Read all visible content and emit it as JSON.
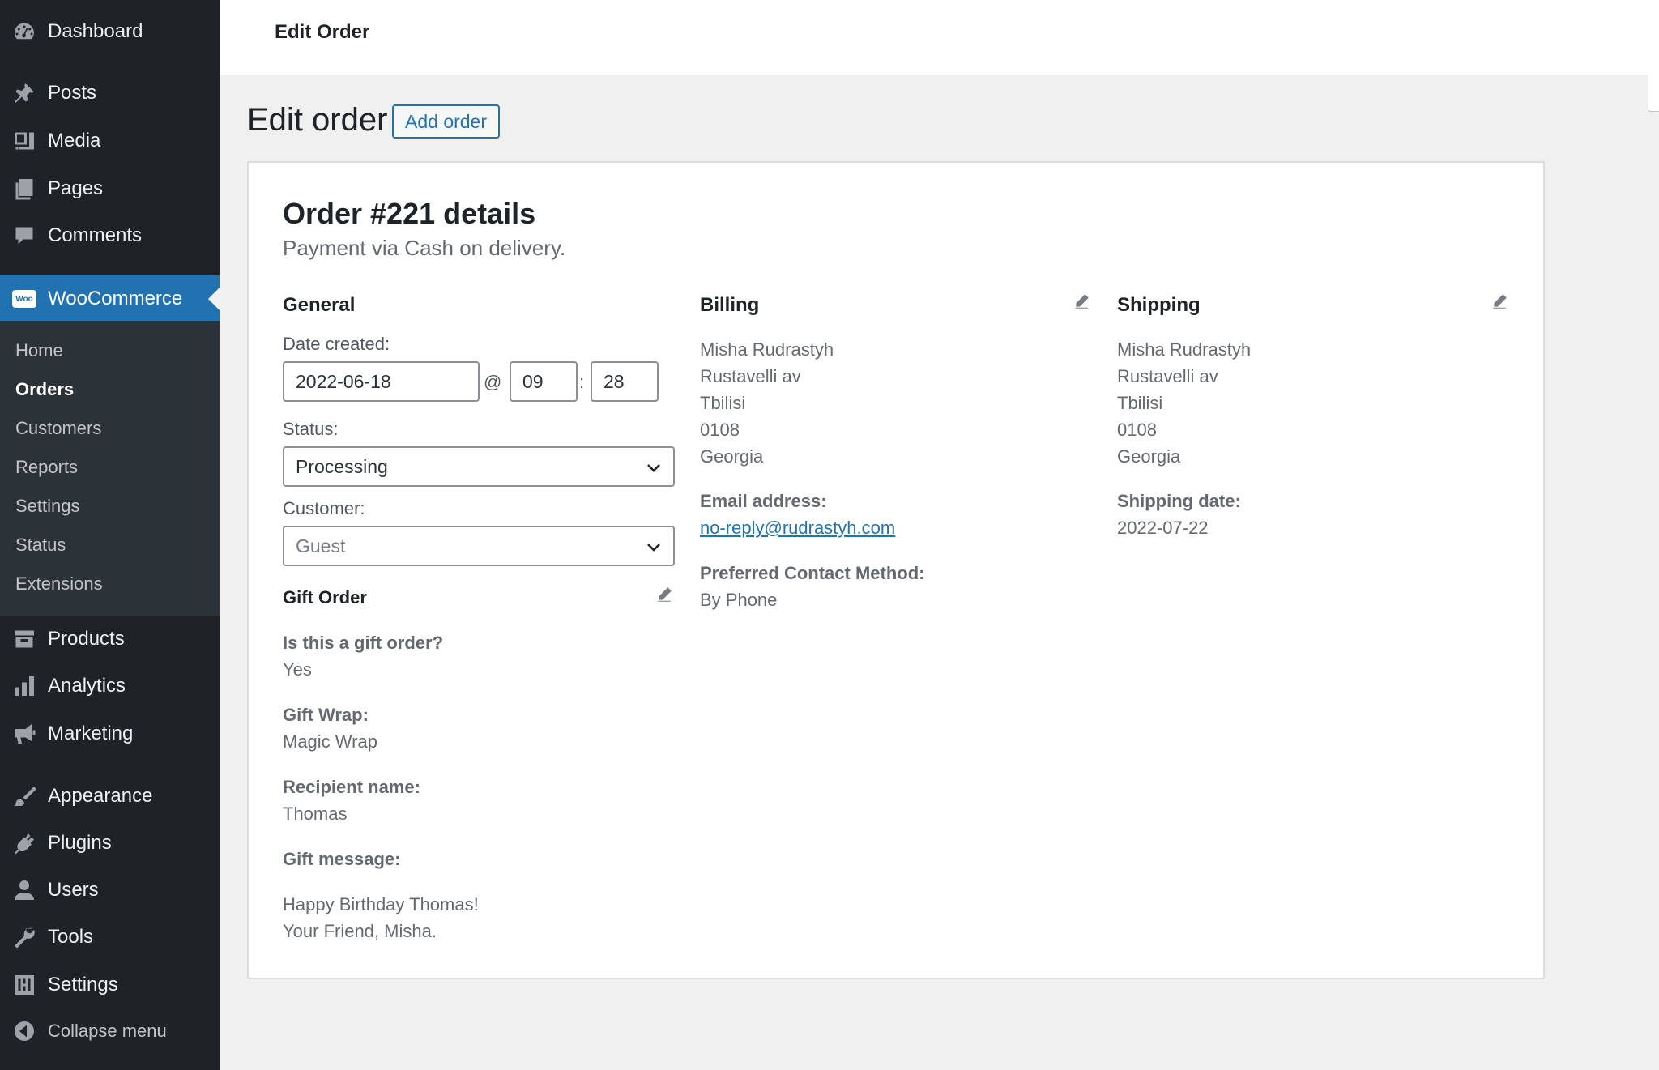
{
  "sidebar": {
    "items": [
      {
        "id": "dashboard",
        "label": "Dashboard",
        "icon": "dashboard-icon"
      },
      {
        "id": "posts",
        "label": "Posts",
        "icon": "pin-icon"
      },
      {
        "id": "media",
        "label": "Media",
        "icon": "media-icon"
      },
      {
        "id": "pages",
        "label": "Pages",
        "icon": "pages-icon"
      },
      {
        "id": "comments",
        "label": "Comments",
        "icon": "comment-icon"
      },
      {
        "id": "woocommerce",
        "label": "WooCommerce",
        "icon": "woocommerce-icon"
      },
      {
        "id": "products",
        "label": "Products",
        "icon": "archive-icon"
      },
      {
        "id": "analytics",
        "label": "Analytics",
        "icon": "bar-chart-icon"
      },
      {
        "id": "marketing",
        "label": "Marketing",
        "icon": "megaphone-icon"
      },
      {
        "id": "appearance",
        "label": "Appearance",
        "icon": "brush-icon"
      },
      {
        "id": "plugins",
        "label": "Plugins",
        "icon": "plug-icon"
      },
      {
        "id": "users",
        "label": "Users",
        "icon": "user-icon"
      },
      {
        "id": "tools",
        "label": "Tools",
        "icon": "wrench-icon"
      },
      {
        "id": "settings",
        "label": "Settings",
        "icon": "sliders-icon"
      },
      {
        "id": "collapse",
        "label": "Collapse menu",
        "icon": "collapse-icon"
      }
    ],
    "submenu": [
      "Home",
      "Orders",
      "Customers",
      "Reports",
      "Settings",
      "Status",
      "Extensions"
    ],
    "woo_logo_text": "Woo"
  },
  "header": {
    "title": "Edit Order"
  },
  "page": {
    "title": "Edit order",
    "add_button": "Add order"
  },
  "order": {
    "heading": "Order #221 details",
    "payment": "Payment via Cash on delivery."
  },
  "general": {
    "heading": "General",
    "date_label": "Date created:",
    "date": "2022-06-18",
    "at": "@",
    "hour": "09",
    "colon": ":",
    "minute": "28",
    "status_label": "Status:",
    "status": "Processing",
    "customer_label": "Customer:",
    "customer": "Guest"
  },
  "gift": {
    "heading": "Gift Order",
    "q_label": "Is this a gift order?",
    "q_value": "Yes",
    "wrap_label": "Gift Wrap:",
    "wrap_value": "Magic Wrap",
    "recipient_label": "Recipient name:",
    "recipient_value": "Thomas",
    "message_label": "Gift message:",
    "message_line1": "Happy Birthday Thomas!",
    "message_line2": "Your Friend, Misha."
  },
  "billing": {
    "heading": "Billing",
    "address": [
      "Misha Rudrastyh",
      "Rustavelli av",
      "Tbilisi",
      "0108",
      "Georgia"
    ],
    "email_label": "Email address:",
    "email": "no-reply@rudrastyh.com",
    "contact_label": "Preferred Contact Method:",
    "contact": "By Phone"
  },
  "shipping": {
    "heading": "Shipping",
    "address": [
      "Misha Rudrastyh",
      "Rustavelli av",
      "Tbilisi",
      "0108",
      "Georgia"
    ],
    "date_label": "Shipping date:",
    "date": "2022-07-22"
  },
  "colors": {
    "sidebar_bg": "#1d2327",
    "accent": "#2271b1",
    "submenu_bg": "#2c3338"
  }
}
